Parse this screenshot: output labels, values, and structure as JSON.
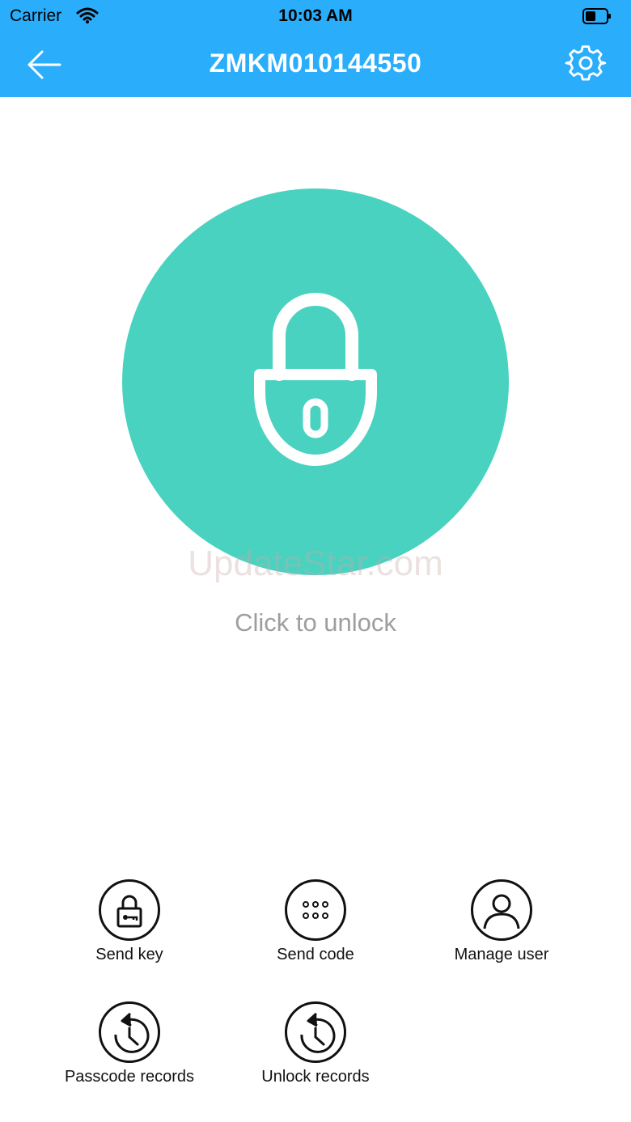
{
  "status_bar": {
    "carrier": "Carrier",
    "time": "10:03 AM"
  },
  "nav": {
    "title": "ZMKM010144550",
    "back_icon": "arrow-left-icon",
    "settings_icon": "gear-icon"
  },
  "lock": {
    "icon": "padlock-icon",
    "hint": "Click to unlock",
    "color": "#4ad2c1"
  },
  "watermark": "UpdateStar.com",
  "actions": [
    {
      "label": "Send key",
      "icon": "key-lock-icon"
    },
    {
      "label": "Send code",
      "icon": "keypad-dots-icon"
    },
    {
      "label": "Manage user",
      "icon": "user-icon"
    },
    {
      "label": "Passcode records",
      "icon": "history-clock-icon"
    },
    {
      "label": "Unlock records",
      "icon": "history-clock-icon"
    }
  ],
  "colors": {
    "header": "#2aaefc",
    "accent": "#4ad2c1"
  }
}
